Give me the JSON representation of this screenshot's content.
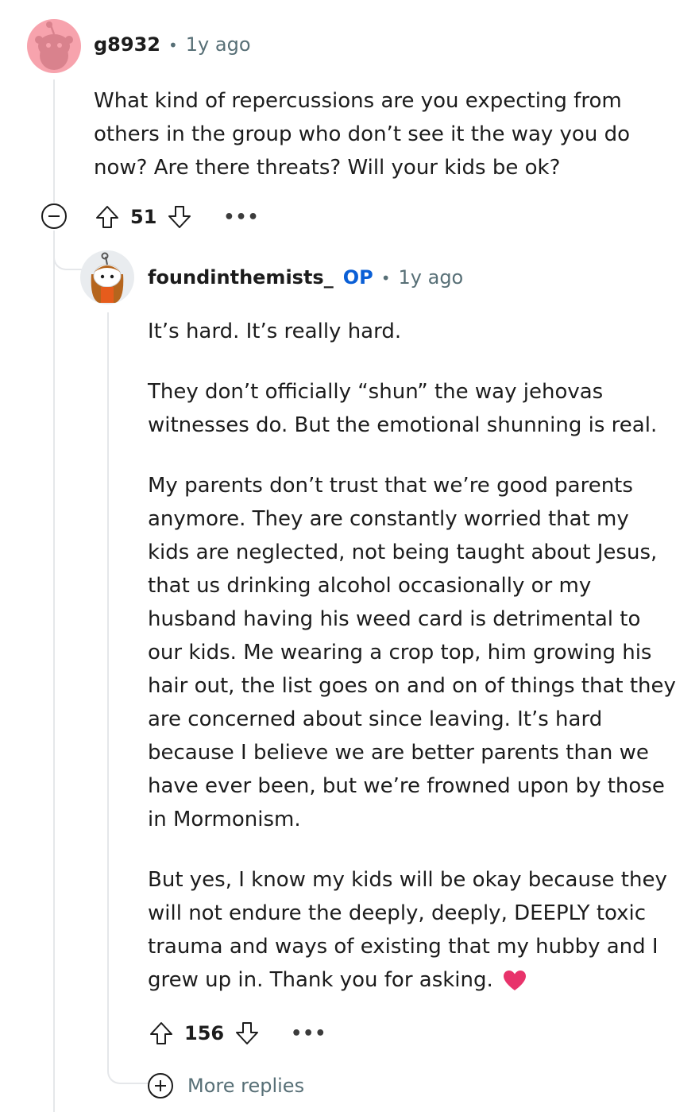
{
  "comment": {
    "author": "g8932",
    "time": "1y ago",
    "body": "What kind of repercussions are you expecting from others in the group who don’t see it the way you do now? Are there threats? Will your kids be ok?",
    "score": "51",
    "more": "•••"
  },
  "reply": {
    "author": "foundinthemists_",
    "op_badge": "OP",
    "time": "1y ago",
    "paragraphs": [
      "It’s hard. It’s really hard.",
      "They don’t officially “shun” the way jehovas witnesses do. But the emotional shunning is real.",
      "My parents don’t trust that we’re good parents anymore. They are constantly worried that my kids are neglected, not being taught about Jesus, that us drinking alcohol occasionally or my husband having his weed card is detrimental to our kids. Me wearing a crop top, him growing his hair out, the list goes on and on of things that they are concerned about since leaving. It’s hard because I believe we are better parents than we have ever been, but we’re frowned upon by those in Mormonism.",
      "But yes, I know my kids will be okay because they will not endure the deeply, deeply, DEEPLY toxic trauma and ways of existing that my hubby and I grew up in. Thank you for asking."
    ],
    "score": "156",
    "more": "•••"
  },
  "more_replies": "More replies",
  "colors": {
    "op": "#0a5fd6",
    "meta": "#576f76",
    "heart": "#e8336b",
    "avatar_1_bg": "#f7a3ad"
  }
}
